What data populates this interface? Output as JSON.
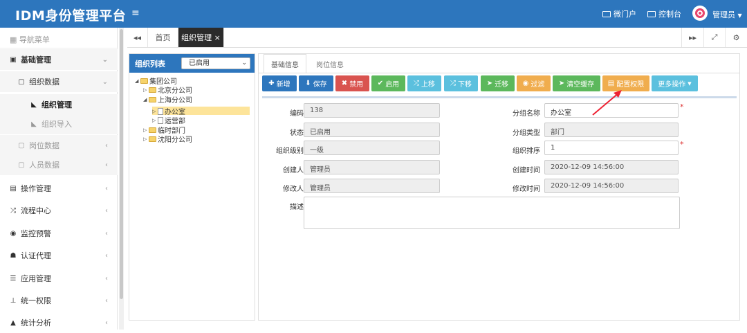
{
  "app": {
    "title": "IDM身份管理平台",
    "menu_toggle": "≡"
  },
  "topnav": {
    "portal": "微门户",
    "console": "控制台",
    "user": "管理员"
  },
  "sidebar": {
    "header": "导航菜单",
    "items": [
      {
        "label": "基础管理",
        "icon": "▣",
        "chev": "⌄"
      },
      {
        "label": "组织数据",
        "icon": "▢",
        "chev": "⌄"
      },
      {
        "label": "组织管理",
        "icon": "◣"
      },
      {
        "label": "组织导入",
        "icon": "◣"
      },
      {
        "label": "岗位数据",
        "icon": "▢",
        "chev": "‹"
      },
      {
        "label": "人员数据",
        "icon": "▢",
        "chev": "‹"
      },
      {
        "label": "操作管理",
        "icon": "▤",
        "chev": "‹"
      },
      {
        "label": "流程中心",
        "icon": "⤮",
        "chev": "‹"
      },
      {
        "label": "监控预警",
        "icon": "◉",
        "chev": "‹"
      },
      {
        "label": "认证代理",
        "icon": "☗",
        "chev": "‹"
      },
      {
        "label": "应用管理",
        "icon": "☰",
        "chev": "‹"
      },
      {
        "label": "统一权限",
        "icon": "⊥",
        "chev": "‹"
      },
      {
        "label": "统计分析",
        "icon": "▲",
        "chev": "‹"
      }
    ]
  },
  "tabs": {
    "prev": "◂◂",
    "home": "首页",
    "current": "组织管理",
    "close": "×",
    "next": "▸▸",
    "expand": "⤢",
    "settings": "⚙"
  },
  "org": {
    "title": "组织列表",
    "filter": "已启用",
    "tree": [
      "集团公司",
      "北京分公司",
      "上海分公司",
      "办公室",
      "运营部",
      "临时部门",
      "沈阳分公司"
    ]
  },
  "detail_tabs": {
    "basic": "基础信息",
    "post": "岗位信息"
  },
  "toolbar": {
    "add": "新增",
    "save": "保存",
    "disable": "禁用",
    "enable": "启用",
    "up": "上移",
    "down": "下移",
    "migrate": "迁移",
    "filter": "过滤",
    "clear_cache": "清空缓存",
    "config_perm": "配置权限",
    "more": "更多操作"
  },
  "form": {
    "code_label": "编码",
    "code": "138",
    "status_label": "状态",
    "status": "已启用",
    "level_label": "组织级别",
    "level": "一级",
    "creator_label": "创建人",
    "creator": "管理员",
    "modifier_label": "修改人",
    "modifier": "管理员",
    "desc_label": "描述",
    "name_label": "分组名称",
    "name": "办公室",
    "type_label": "分组类型",
    "type": "部门",
    "sort_label": "组织排序",
    "sort": "1",
    "ctime_label": "创建时间",
    "ctime": "2020-12-09 14:56:00",
    "mtime_label": "修改时间",
    "mtime": "2020-12-09 14:56:00"
  },
  "colors": {
    "primary": "#2d76bd",
    "danger": "#d9534f",
    "success": "#5cb85c",
    "info": "#5bc0de",
    "warning": "#f0ad4e",
    "highlight": "#fde49a",
    "arrow": "#e23"
  }
}
